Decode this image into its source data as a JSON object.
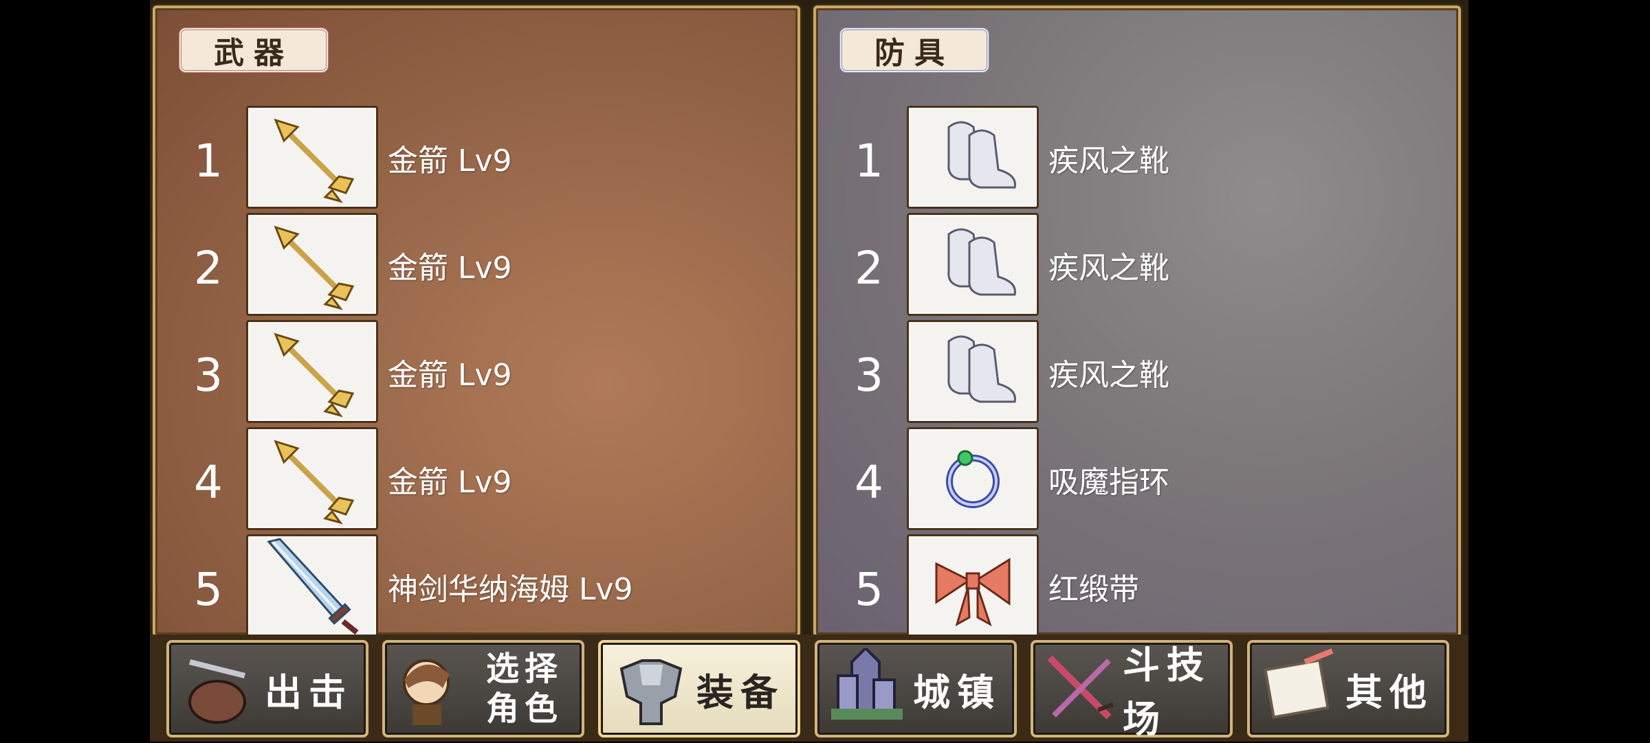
{
  "weapons": {
    "title": "武器",
    "items": [
      {
        "num": "1",
        "name": "金箭 Lv9",
        "icon": "golden-arrow"
      },
      {
        "num": "2",
        "name": "金箭 Lv9",
        "icon": "golden-arrow"
      },
      {
        "num": "3",
        "name": "金箭 Lv9",
        "icon": "golden-arrow"
      },
      {
        "num": "4",
        "name": "金箭 Lv9",
        "icon": "golden-arrow"
      },
      {
        "num": "5",
        "name": "神剑华纳海姆 Lv9",
        "icon": "sword"
      }
    ]
  },
  "armor": {
    "title": "防具",
    "items": [
      {
        "num": "1",
        "name": "疾风之靴",
        "icon": "boots"
      },
      {
        "num": "2",
        "name": "疾风之靴",
        "icon": "boots"
      },
      {
        "num": "3",
        "name": "疾风之靴",
        "icon": "boots"
      },
      {
        "num": "4",
        "name": "吸魔指环",
        "icon": "ring"
      },
      {
        "num": "5",
        "name": "红缎带",
        "icon": "ribbon"
      }
    ]
  },
  "tabs": [
    {
      "label": "出击",
      "icon": "sortie-icon"
    },
    {
      "label_line1": "选择",
      "label_line2": "角色",
      "icon": "character-icon"
    },
    {
      "label": "装备",
      "icon": "armor-icon",
      "active": true
    },
    {
      "label": "城镇",
      "icon": "town-icon"
    },
    {
      "label": "斗技场",
      "icon": "arena-icon"
    },
    {
      "label": "其他",
      "icon": "scroll-icon"
    }
  ]
}
